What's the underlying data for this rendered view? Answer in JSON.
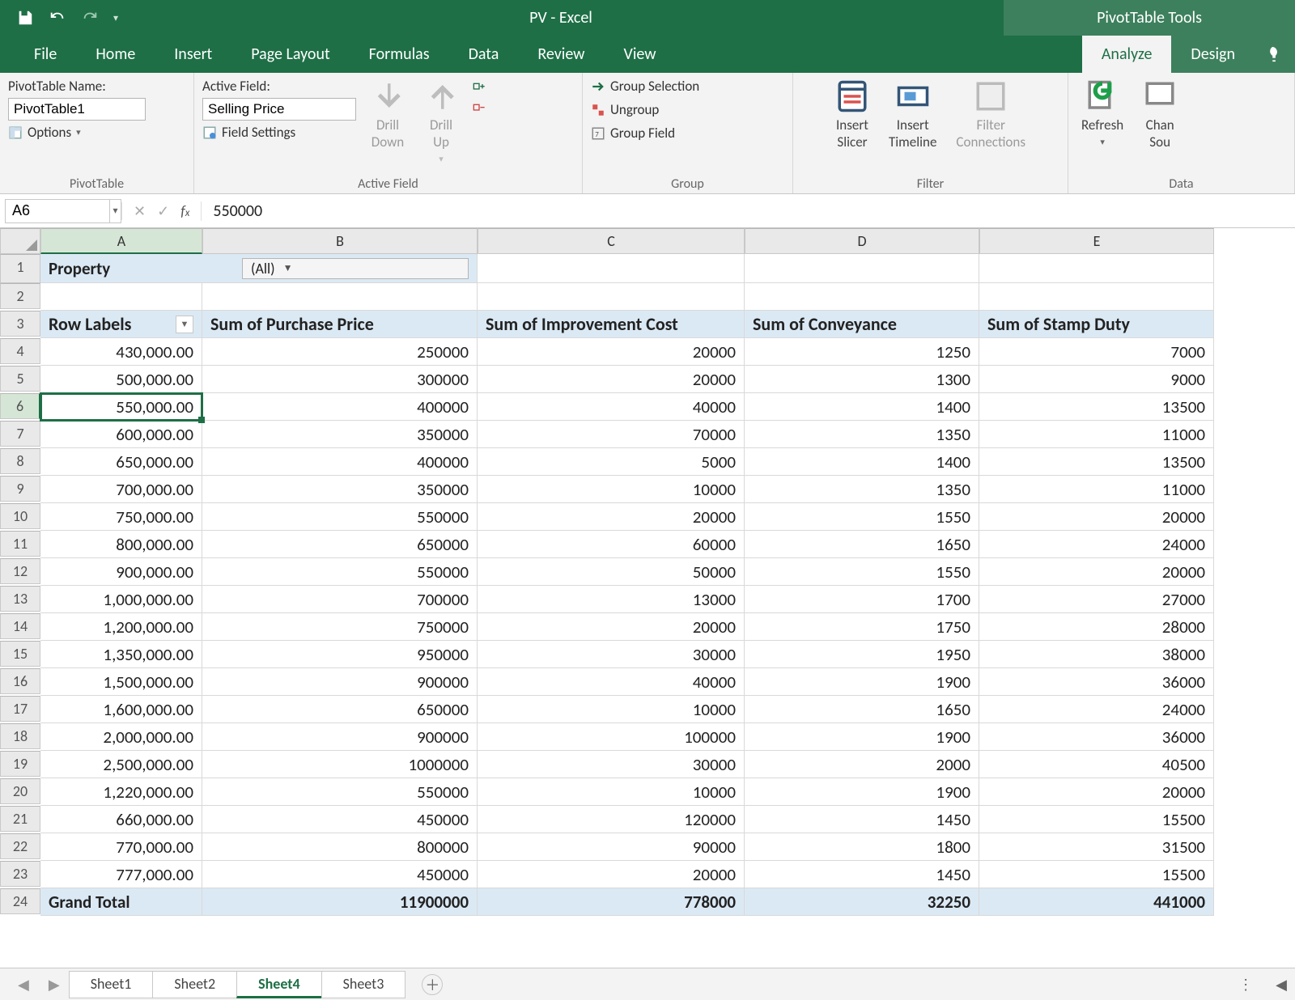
{
  "titlebar": {
    "title": "PV - Excel",
    "context": "PivotTable Tools"
  },
  "tabs": {
    "file": "File",
    "home": "Home",
    "insert": "Insert",
    "pagelayout": "Page Layout",
    "formulas": "Formulas",
    "data": "Data",
    "review": "Review",
    "view": "View",
    "analyze": "Analyze",
    "design": "Design"
  },
  "ribbon": {
    "pivotTable": {
      "nameLabel": "PivotTable Name:",
      "nameValue": "PivotTable1",
      "options": "Options",
      "group": "PivotTable"
    },
    "activeField": {
      "label": "Active Field:",
      "value": "Selling Price",
      "fieldSettings": "Field Settings",
      "drillDown": "Drill\nDown",
      "drillUp": "Drill\nUp",
      "group": "Active Field"
    },
    "groupg": {
      "groupSelection": "Group Selection",
      "ungroup": "Ungroup",
      "groupField": "Group Field",
      "group": "Group"
    },
    "filter": {
      "slicer": "Insert\nSlicer",
      "timeline": "Insert\nTimeline",
      "connections": "Filter\nConnections",
      "group": "Filter"
    },
    "dataG": {
      "refresh": "Refresh",
      "change": "Chan\nSou",
      "group": "Data"
    }
  },
  "formulaBar": {
    "cellRef": "A6",
    "formula": "550000"
  },
  "columns": [
    "A",
    "B",
    "C",
    "D",
    "E"
  ],
  "pivot": {
    "pageFieldName": "Property",
    "pageFieldValue": "(All)",
    "rowLabelsHdr": "Row Labels",
    "valueHeaders": [
      "Sum of Purchase Price",
      "Sum of Improvement Cost",
      "Sum of Conveyance",
      "Sum of Stamp Duty"
    ],
    "rows": [
      {
        "n": 4,
        "label": "430,000.00",
        "v": [
          "250000",
          "20000",
          "1250",
          "7000"
        ]
      },
      {
        "n": 5,
        "label": "500,000.00",
        "v": [
          "300000",
          "20000",
          "1300",
          "9000"
        ]
      },
      {
        "n": 6,
        "label": "550,000.00",
        "v": [
          "400000",
          "40000",
          "1400",
          "13500"
        ],
        "selected": true
      },
      {
        "n": 7,
        "label": "600,000.00",
        "v": [
          "350000",
          "70000",
          "1350",
          "11000"
        ]
      },
      {
        "n": 8,
        "label": "650,000.00",
        "v": [
          "400000",
          "5000",
          "1400",
          "13500"
        ]
      },
      {
        "n": 9,
        "label": "700,000.00",
        "v": [
          "350000",
          "10000",
          "1350",
          "11000"
        ]
      },
      {
        "n": 10,
        "label": "750,000.00",
        "v": [
          "550000",
          "20000",
          "1550",
          "20000"
        ]
      },
      {
        "n": 11,
        "label": "800,000.00",
        "v": [
          "650000",
          "60000",
          "1650",
          "24000"
        ]
      },
      {
        "n": 12,
        "label": "900,000.00",
        "v": [
          "550000",
          "50000",
          "1550",
          "20000"
        ]
      },
      {
        "n": 13,
        "label": "1,000,000.00",
        "v": [
          "700000",
          "13000",
          "1700",
          "27000"
        ]
      },
      {
        "n": 14,
        "label": "1,200,000.00",
        "v": [
          "750000",
          "20000",
          "1750",
          "28000"
        ]
      },
      {
        "n": 15,
        "label": "1,350,000.00",
        "v": [
          "950000",
          "30000",
          "1950",
          "38000"
        ]
      },
      {
        "n": 16,
        "label": "1,500,000.00",
        "v": [
          "900000",
          "40000",
          "1900",
          "36000"
        ]
      },
      {
        "n": 17,
        "label": "1,600,000.00",
        "v": [
          "650000",
          "10000",
          "1650",
          "24000"
        ]
      },
      {
        "n": 18,
        "label": "2,000,000.00",
        "v": [
          "900000",
          "100000",
          "1900",
          "36000"
        ]
      },
      {
        "n": 19,
        "label": "2,500,000.00",
        "v": [
          "1000000",
          "30000",
          "2000",
          "40500"
        ]
      },
      {
        "n": 20,
        "label": "1,220,000.00",
        "v": [
          "550000",
          "10000",
          "1900",
          "20000"
        ]
      },
      {
        "n": 21,
        "label": "660,000.00",
        "v": [
          "450000",
          "120000",
          "1450",
          "15500"
        ]
      },
      {
        "n": 22,
        "label": "770,000.00",
        "v": [
          "800000",
          "90000",
          "1800",
          "31500"
        ]
      },
      {
        "n": 23,
        "label": "777,000.00",
        "v": [
          "450000",
          "20000",
          "1450",
          "15500"
        ]
      }
    ],
    "grandTotal": {
      "n": 24,
      "label": "Grand Total",
      "v": [
        "11900000",
        "778000",
        "32250",
        "441000"
      ]
    }
  },
  "sheets": {
    "list": [
      "Sheet1",
      "Sheet2",
      "Sheet4",
      "Sheet3"
    ],
    "active": "Sheet4"
  }
}
